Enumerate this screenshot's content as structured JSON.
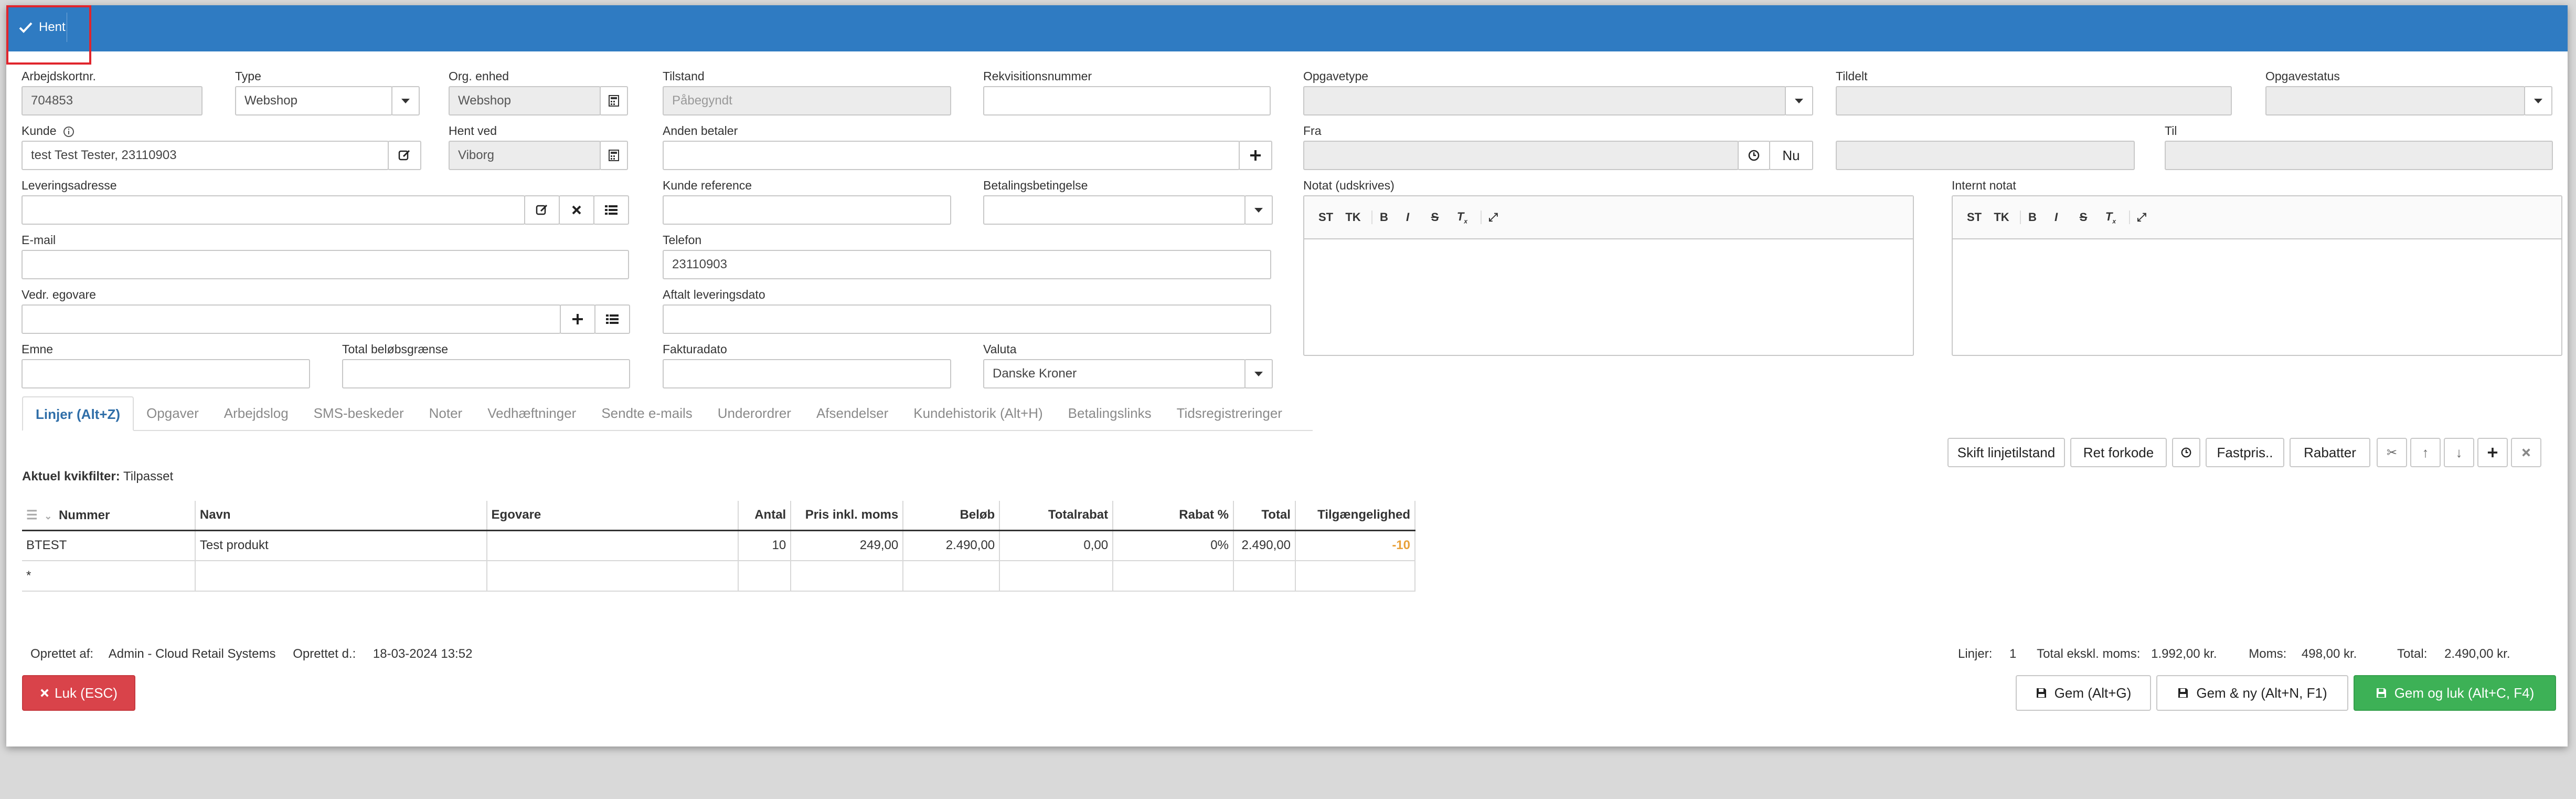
{
  "toolbar": {
    "hent_label": "Hent"
  },
  "form": {
    "arbejdskortnr": {
      "label": "Arbejdskortnr.",
      "value": "704853"
    },
    "type": {
      "label": "Type",
      "value": "Webshop"
    },
    "org_enhed": {
      "label": "Org. enhed",
      "value": "Webshop"
    },
    "tilstand": {
      "label": "Tilstand",
      "value": "Påbegyndt"
    },
    "rekvisitionsnummer": {
      "label": "Rekvisitionsnummer",
      "value": ""
    },
    "opgavetype": {
      "label": "Opgavetype",
      "value": ""
    },
    "tildelt": {
      "label": "Tildelt",
      "value": ""
    },
    "opgavestatus": {
      "label": "Opgavestatus",
      "value": ""
    },
    "kunde": {
      "label": "Kunde",
      "value": "test Test Tester, 23110903"
    },
    "hent_ved": {
      "label": "Hent ved",
      "value": "Viborg"
    },
    "anden_betaler": {
      "label": "Anden betaler",
      "value": ""
    },
    "fra": {
      "label": "Fra",
      "value": "",
      "nu_label": "Nu"
    },
    "til": {
      "label": "Til",
      "value": ""
    },
    "leveringsadresse": {
      "label": "Leveringsadresse",
      "value": ""
    },
    "kunde_reference": {
      "label": "Kunde reference",
      "value": ""
    },
    "betalingsbetingelse": {
      "label": "Betalingsbetingelse",
      "value": ""
    },
    "notat": {
      "label": "Notat (udskrives)"
    },
    "internt_notat": {
      "label": "Internt notat"
    },
    "email": {
      "label": "E-mail",
      "value": ""
    },
    "telefon": {
      "label": "Telefon",
      "value": "23110903"
    },
    "vedr_egovare": {
      "label": "Vedr. egovare",
      "value": ""
    },
    "aftalt_leveringsdato": {
      "label": "Aftalt leveringsdato",
      "value": ""
    },
    "emne": {
      "label": "Emne",
      "value": ""
    },
    "total_belobsgraense": {
      "label": "Total beløbsgrænse",
      "value": ""
    },
    "fakturadato": {
      "label": "Fakturadato",
      "value": ""
    },
    "valuta": {
      "label": "Valuta",
      "value": "Danske Kroner"
    }
  },
  "editor_toolbar": {
    "st": "ST",
    "tk": "TK"
  },
  "tabs": [
    "Linjer (Alt+Z)",
    "Opgaver",
    "Arbejdslog",
    "SMS-beskeder",
    "Noter",
    "Vedhæftninger",
    "Sendte e-mails",
    "Underordrer",
    "Afsendelser",
    "Kundehistorik (Alt+H)",
    "Betalingslinks",
    "Tidsregistreringer"
  ],
  "line_actions": {
    "skift": "Skift linjetilstand",
    "ret": "Ret forkode",
    "fastpris": "Fastpris..",
    "rabatter": "Rabatter"
  },
  "filter": {
    "label": "Aktuel kvikfilter:",
    "value": "Tilpasset"
  },
  "table": {
    "headers": [
      "Nummer",
      "Navn",
      "Egovare",
      "Antal",
      "Pris inkl. moms",
      "Beløb",
      "Totalrabat",
      "Rabat %",
      "Total",
      "Tilgængelighed"
    ],
    "rows": [
      [
        "BTEST",
        "Test produkt",
        "",
        "10",
        "249,00",
        "2.490,00",
        "0,00",
        "0%",
        "2.490,00",
        "-10"
      ]
    ],
    "new_row_marker": "*",
    "availability_color": "#e8a13a"
  },
  "footer": {
    "oprettet_af_label": "Oprettet af:",
    "oprettet_af": "Admin - Cloud Retail Systems",
    "oprettet_d_label": "Oprettet d.:",
    "oprettet_d": "18-03-2024 13:52",
    "linjer_label": "Linjer:",
    "linjer": "1",
    "total_ekskl_label": "Total ekskl. moms:",
    "total_ekskl": "1.992,00 kr.",
    "moms_label": "Moms:",
    "moms": "498,00 kr.",
    "total_label": "Total:",
    "total": "2.490,00 kr."
  },
  "buttons": {
    "luk": "Luk (ESC)",
    "gem": "Gem (Alt+G)",
    "gem_ny": "Gem & ny (Alt+N, F1)",
    "gem_luk": "Gem og luk (Alt+C, F4)"
  },
  "colors": {
    "header_blue": "#2f7bc2",
    "danger": "#d9434a",
    "success": "#3db156",
    "highlight": "#e0252d"
  }
}
